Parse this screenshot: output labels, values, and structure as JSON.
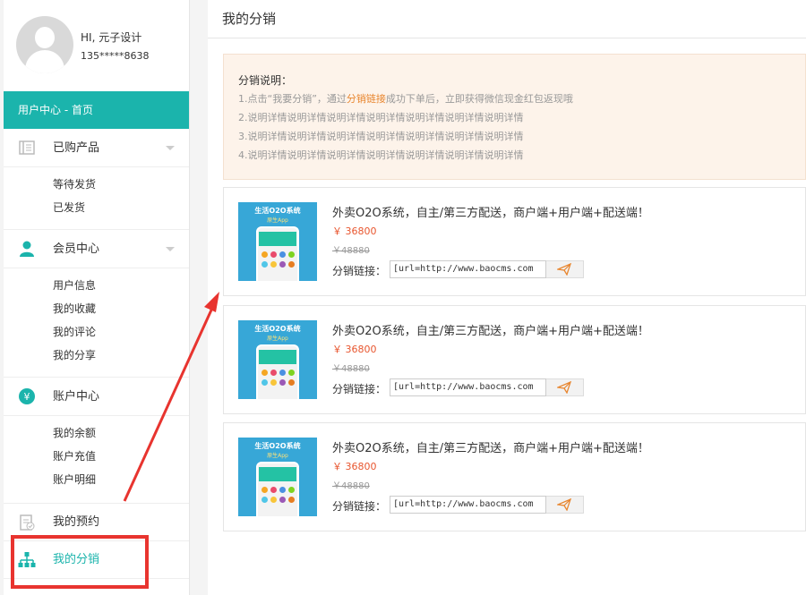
{
  "user": {
    "greeting": "HI, 元子设计",
    "phone": "135*****8638"
  },
  "sidebar": {
    "home": "用户中心 - 首页",
    "groups": [
      {
        "label": "已购产品",
        "items": [
          "等待发货",
          "已发货"
        ]
      },
      {
        "label": "会员中心",
        "items": [
          "用户信息",
          "我的收藏",
          "我的评论",
          "我的分享"
        ]
      },
      {
        "label": "账户中心",
        "items": [
          "我的余额",
          "账户充值",
          "账户明细"
        ]
      }
    ],
    "reservation": "我的预约",
    "distribution": "我的分销"
  },
  "main": {
    "title": "我的分销",
    "notice": {
      "title": "分销说明：",
      "line1_pre": "1.点击“我要分销”，通过",
      "line1_hl": "分销链接",
      "line1_post": "成功下单后，立即获得微信现金红包返现哦",
      "line2": "2.说明详情说明详情说明详情说明详情说明详情说明详情说明详情",
      "line3": "3.说明详情说明详情说明详情说明详情说明详情说明详情说明详情",
      "line4": "4.说明详情说明详情说明详情说明详情说明详情说明详情说明详情"
    },
    "products": [
      {
        "thumb_title": "生活O2O系统",
        "thumb_sub": "原生App",
        "title": "外卖O2O系统，自主/第三方配送，商户端+用户端+配送端！",
        "price": "￥ 36800",
        "old_price": "￥48880",
        "link_label": "分销链接：",
        "link": "[url=http://www.baocms.com"
      },
      {
        "thumb_title": "生活O2O系统",
        "thumb_sub": "原生App",
        "title": "外卖O2O系统，自主/第三方配送，商户端+用户端+配送端！",
        "price": "￥ 36800",
        "old_price": "￥48880",
        "link_label": "分销链接：",
        "link": "[url=http://www.baocms.com"
      },
      {
        "thumb_title": "生活O2O系统",
        "thumb_sub": "原生App",
        "title": "外卖O2O系统，自主/第三方配送，商户端+用户端+配送端！",
        "price": "￥ 36800",
        "old_price": "￥48880",
        "link_label": "分销链接：",
        "link": "[url=http://www.baocms.com"
      }
    ]
  },
  "colors": {
    "accent": "#1bb4ac",
    "annotation": "#e8342f",
    "price": "#e8562f"
  },
  "icons": [
    "products-icon",
    "member-icon",
    "account-icon",
    "reservation-icon",
    "distribution-icon",
    "send-icon"
  ]
}
